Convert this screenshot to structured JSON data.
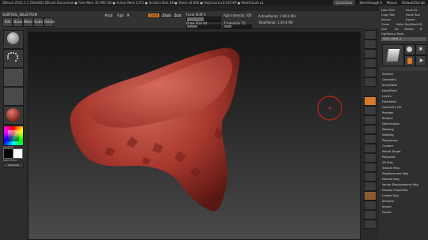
{
  "window": {
    "title": "ZBrush 2021.1.1 [SteliSD]     ZBrush Document    ● Free Mem 35.990 GB ● Active Mem 1373 ● Scratch Disk 48 ● Timer ▸0.006 ● PolyCount ▸2.010 KP ● MeshCount ▸1",
    "right_items": [
      "QuickSave",
      "See-through 0",
      "Menus",
      "DefaultZScript"
    ]
  },
  "toolbar": {
    "doc_title": "SUBTOOL_SELECTION",
    "buttons": {
      "edit": "Edit",
      "draw": "Draw",
      "move": "Move",
      "scale": "Scale",
      "rotate": "Rotate"
    },
    "labels": {
      "mrgb": "Mrgb",
      "rgb": "Rgb",
      "m": "M",
      "zadd": "Zadd",
      "zsub": "Zsub",
      "zcut": "Zcut",
      "focal_shift": "Focal Shift 0",
      "draw_size": "Draw Size 64",
      "dynamic": "Dynamic",
      "rgb_intensity": "Rgb Intensity 100",
      "z_intensity": "Z Intensity 25",
      "active_points": "ActivePoints: 1.00 4 Mil",
      "total_points": "TotalPoints: 1.00 4 Mil"
    },
    "focal_shift_value": 0.0,
    "draw_size_fraction": 0.3,
    "z_intensity_fraction": 0.25
  },
  "leftpanel": {
    "labels": [
      "Gradient",
      "SwitchColor",
      "Alternate"
    ]
  },
  "shelf": {
    "items": [
      "BPR",
      "SPix 3",
      "Scroll",
      "Zoom",
      "Actual",
      "AAHalf",
      "Persp",
      "Floor",
      "Local",
      "LSym",
      "Gxyz",
      "Frame",
      "Move",
      "Scale",
      "Rotate",
      "PolyF",
      "Transp",
      "Ghost",
      "Solo",
      "Xpose"
    ]
  },
  "rightpanel": {
    "top_buttons": [
      "Load Tool",
      "Save As",
      "Copy Tool",
      "Paste Tool",
      "Import",
      "Export",
      "Clone",
      "Make PolyMesh3D",
      "GoZ",
      "All",
      "Visible",
      "R"
    ],
    "lightbox_label": "Lightbox ▸ Tools",
    "current_tool": "skull_sdwd_1",
    "thumb_labels": [
      "SimpleBrush",
      "PolyMesh3D",
      "Cylinder3D"
    ],
    "sections": [
      "SubTool",
      "Geometry",
      "ArrayMesh",
      "NanoMesh",
      "Layers",
      "FiberMesh",
      "Geometry HD",
      "Preview",
      "Surface",
      "Deformation",
      "Masking",
      "Visibility",
      "Polygroups",
      "Contact",
      "Morph Target",
      "Polypaint",
      "UV Map",
      "Texture Map",
      "Displacement Map",
      "Normal Map",
      "Vector Displacement Map",
      "Display Properties",
      "Unified Skin",
      "Initialize",
      "Import",
      "Export"
    ]
  },
  "colors": {
    "accent": "#d87a2b",
    "clay": "#b8473d",
    "brush_cursor": "#c0201a"
  }
}
